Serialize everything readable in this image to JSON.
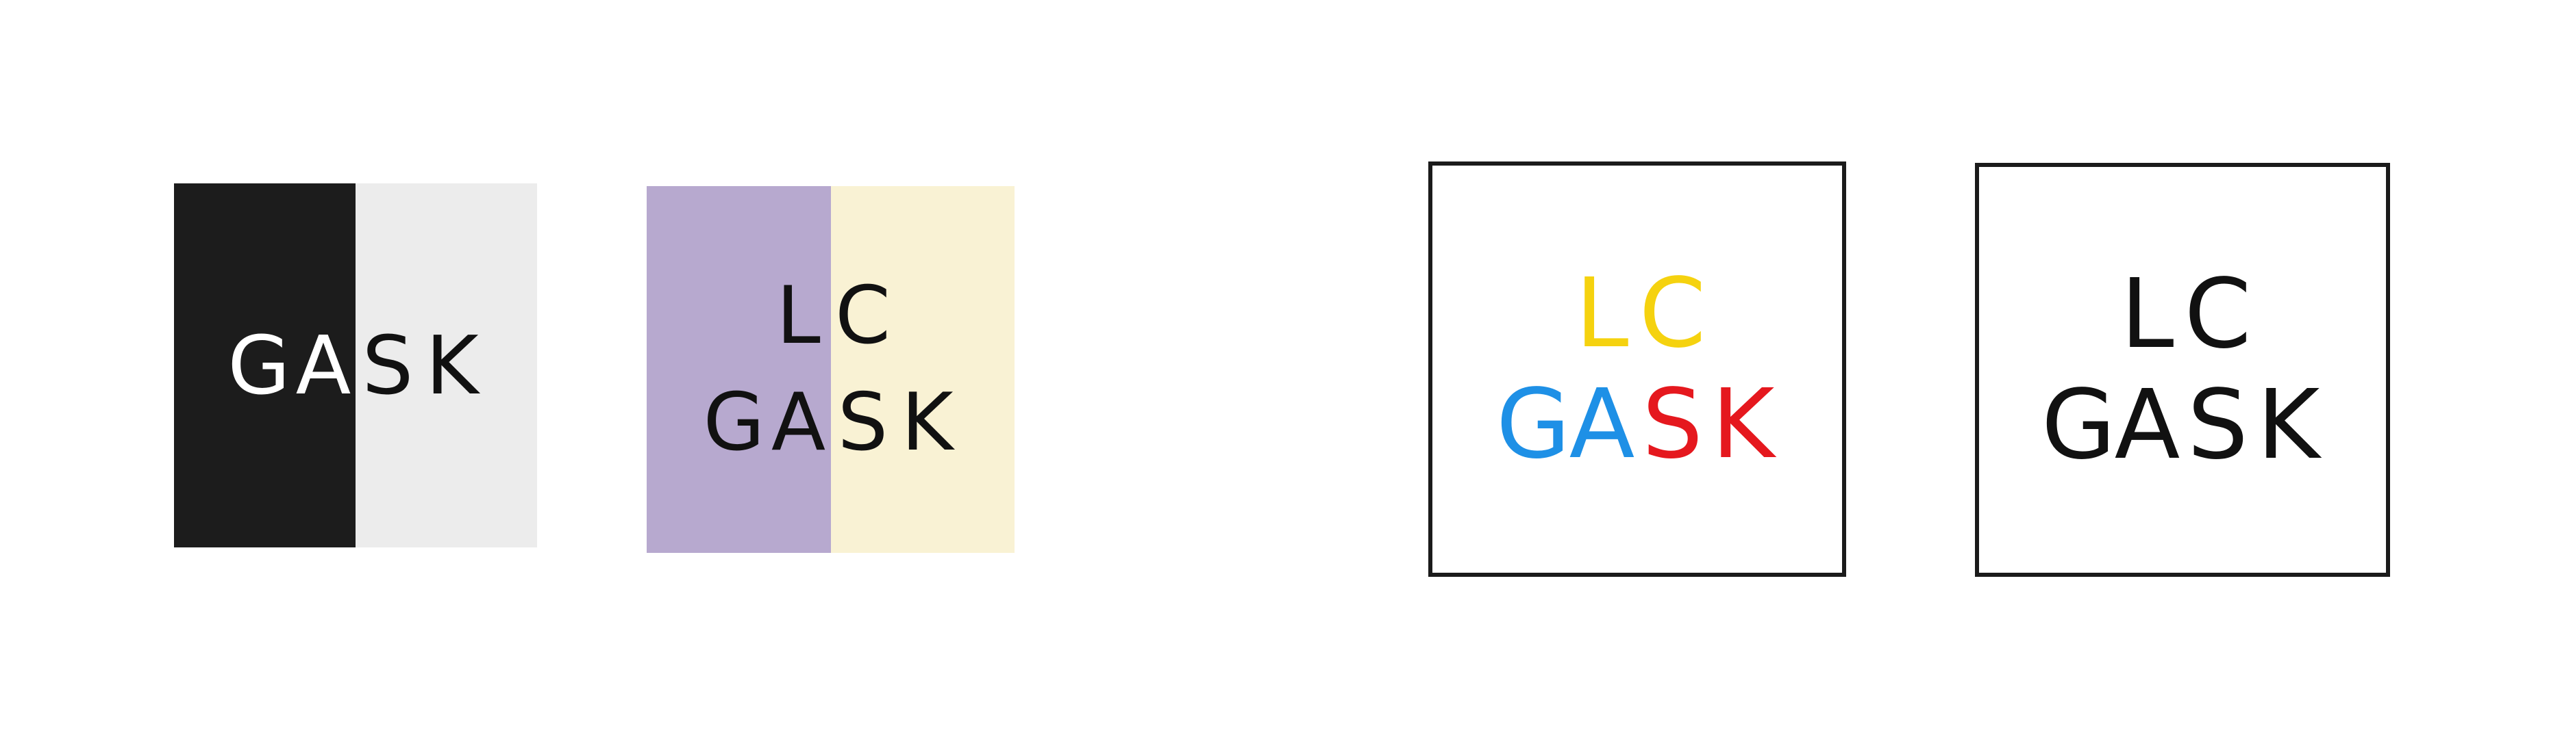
{
  "logos": [
    {
      "colors": {
        "left_panel": "#1c1c1c",
        "right_panel": "#ececec"
      },
      "lines": [
        [
          {
            "text": "G",
            "color": "#ffffff"
          },
          {
            "text": "A",
            "color": "#ffffff"
          },
          {
            "text": "S",
            "color": "#111111"
          },
          {
            "text": "K",
            "color": "#111111"
          }
        ]
      ]
    },
    {
      "colors": {
        "left_panel": "#b7a9cf",
        "right_panel": "#f9f2d4"
      },
      "lines": [
        [
          {
            "text": "L",
            "color": "#111111"
          },
          {
            "text": "C",
            "color": "#111111"
          }
        ],
        [
          {
            "text": "G",
            "color": "#111111"
          },
          {
            "text": "A",
            "color": "#111111"
          },
          {
            "text": "S",
            "color": "#111111"
          },
          {
            "text": "K",
            "color": "#111111"
          }
        ]
      ]
    },
    {
      "colors": {
        "border": "#1b1b1b",
        "background": "#ffffff"
      },
      "lines": [
        [
          {
            "text": "L",
            "color": "#f5d20f"
          },
          {
            "text": "C",
            "color": "#f5d20f"
          }
        ],
        [
          {
            "text": "G",
            "color": "#1e90e6"
          },
          {
            "text": "A",
            "color": "#1e90e6"
          },
          {
            "text": "S",
            "color": "#e5181e"
          },
          {
            "text": "K",
            "color": "#e5181e"
          }
        ]
      ]
    },
    {
      "colors": {
        "border": "#1b1b1b",
        "background": "#ffffff"
      },
      "lines": [
        [
          {
            "text": "L",
            "color": "#111111"
          },
          {
            "text": "C",
            "color": "#111111"
          }
        ],
        [
          {
            "text": "G",
            "color": "#111111"
          },
          {
            "text": "A",
            "color": "#111111"
          },
          {
            "text": "S",
            "color": "#111111"
          },
          {
            "text": "K",
            "color": "#111111"
          }
        ]
      ]
    }
  ]
}
